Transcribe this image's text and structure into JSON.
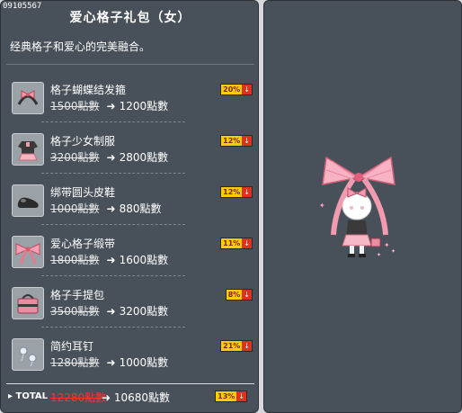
{
  "header": {
    "code": "09105567",
    "title": "爱心格子礼包（女）",
    "description": "经典格子和爱心的完美融合。"
  },
  "items": [
    {
      "name": "格子蝴蝶结发箍",
      "old_price": "1500點數",
      "new_price": "1200點數",
      "discount": "20%",
      "icon": "bow-headband-icon"
    },
    {
      "name": "格子少女制服",
      "old_price": "3200點數",
      "new_price": "2800點數",
      "discount": "12%",
      "icon": "uniform-icon"
    },
    {
      "name": "绑带圆头皮鞋",
      "old_price": "1000點數",
      "new_price": "880點數",
      "discount": "12%",
      "icon": "shoes-icon"
    },
    {
      "name": "爱心格子缎带",
      "old_price": "1800點數",
      "new_price": "1600點數",
      "discount": "11%",
      "icon": "ribbon-icon"
    },
    {
      "name": "格子手提包",
      "old_price": "3500點數",
      "new_price": "3200點數",
      "discount": "8%",
      "icon": "handbag-icon"
    },
    {
      "name": "简约耳钉",
      "old_price": "1280點數",
      "new_price": "1000點數",
      "discount": "21%",
      "icon": "earring-icon"
    }
  ],
  "total": {
    "label": "TOTAL",
    "old_price": "12280點數",
    "new_price": "10680點數",
    "discount": "13%"
  },
  "colors": {
    "panel": "#485159",
    "badge_yellow": "#ffcc00",
    "badge_red": "#e03020",
    "total_old": "#ff3030"
  }
}
